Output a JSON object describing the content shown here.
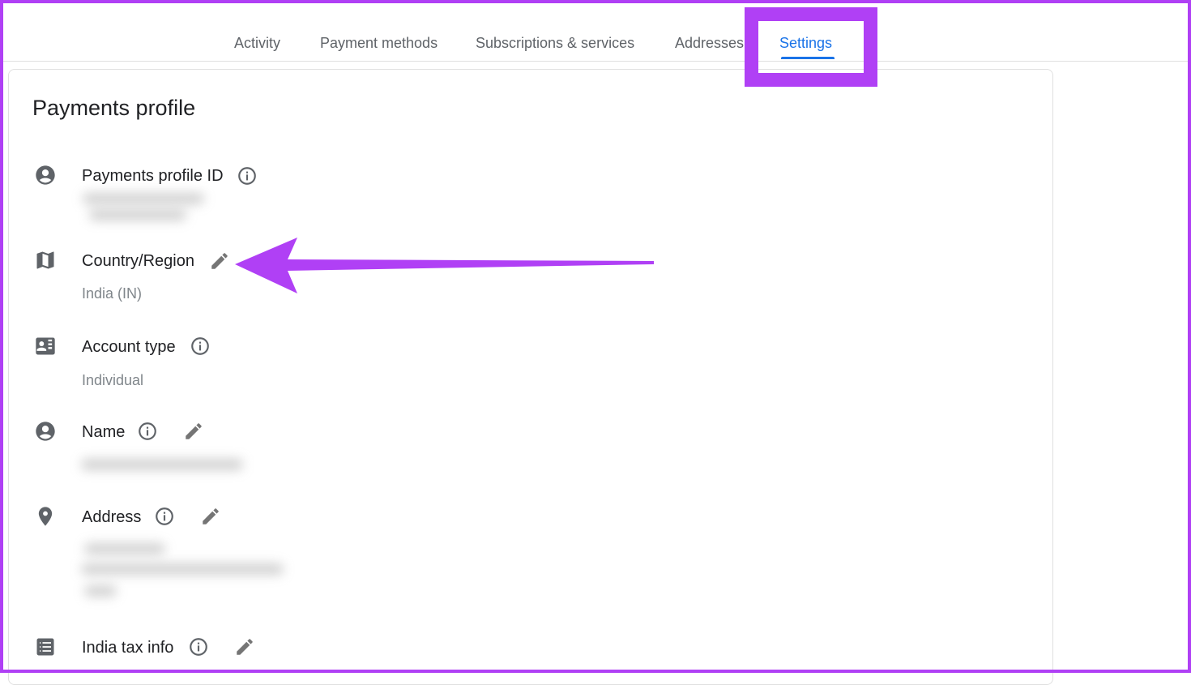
{
  "tabs": [
    {
      "label": "Activity"
    },
    {
      "label": "Payment methods"
    },
    {
      "label": "Subscriptions & services"
    },
    {
      "label": "Addresses"
    },
    {
      "label": "Settings",
      "active": true
    }
  ],
  "card": {
    "title": "Payments profile"
  },
  "rows": {
    "profile_id": {
      "label": "Payments profile ID",
      "icon": "account-circle-icon"
    },
    "country": {
      "label": "Country/Region",
      "value": "India (IN)",
      "icon": "map-icon"
    },
    "account_type": {
      "label": "Account type",
      "value": "Individual",
      "icon": "id-card-icon"
    },
    "name": {
      "label": "Name",
      "icon": "account-circle-icon"
    },
    "address": {
      "label": "Address",
      "icon": "location-pin-icon"
    },
    "tax": {
      "label": "India tax info",
      "icon": "list-icon"
    }
  },
  "colors": {
    "accent": "#1a73e8",
    "highlight": "#b040f5",
    "icon_gray": "#5f6368"
  }
}
